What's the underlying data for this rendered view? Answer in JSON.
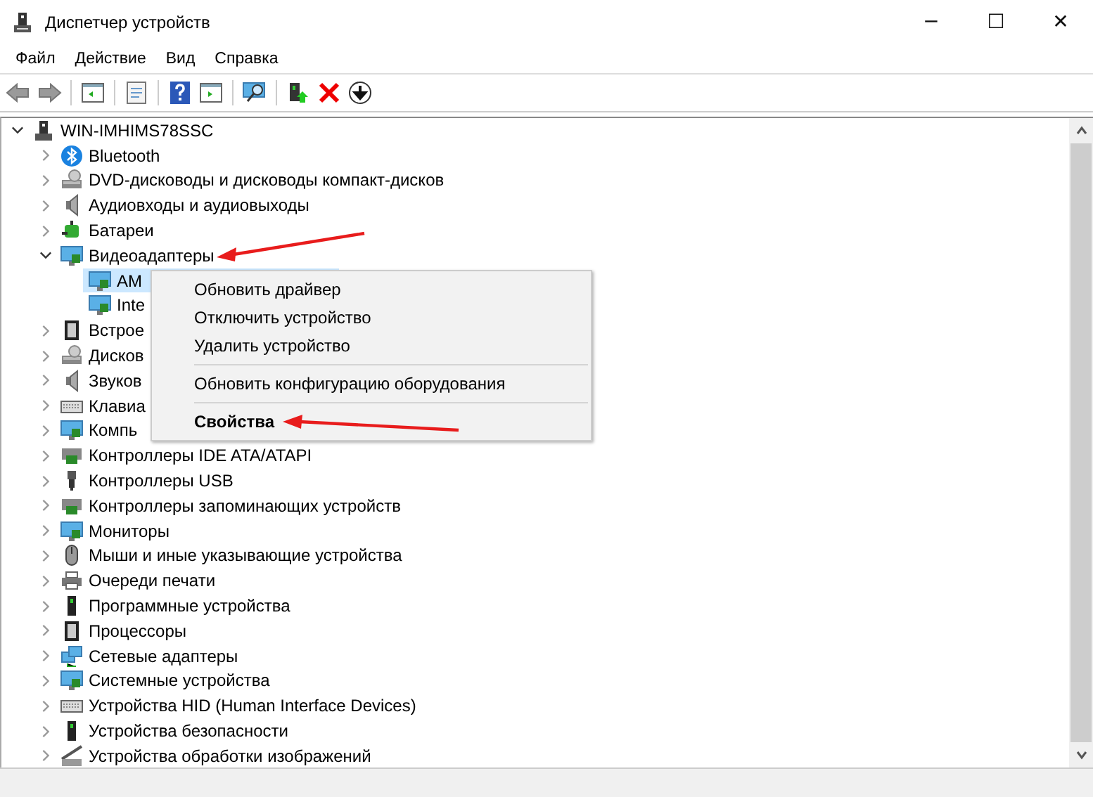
{
  "window": {
    "title": "Диспетчер устройств",
    "controls": [
      "─",
      "☐",
      "✕"
    ]
  },
  "menu": [
    "Файл",
    "Действие",
    "Вид",
    "Справка"
  ],
  "tree": [
    {
      "label": "WIN-IMHIMS78SSC",
      "expanded": true,
      "selected": false,
      "children": [
        {
          "label": "Bluetooth",
          "expanded": false,
          "selected": false
        },
        {
          "label": "DVD-дисководы и дисководы компакт-дисков",
          "expanded": false,
          "selected": false
        },
        {
          "label": "Аудиовходы и аудиовыходы",
          "expanded": false,
          "selected": false
        },
        {
          "label": "Батареи",
          "expanded": false,
          "selected": false
        },
        {
          "label": "Видеоадаптеры",
          "expanded": true,
          "selected": false,
          "children": [
            {
              "label": "AM",
              "selected": true
            },
            {
              "label": "Inte",
              "selected": false
            }
          ]
        },
        {
          "label": "Встрое",
          "expanded": false,
          "selected": false
        },
        {
          "label": "Дисков",
          "expanded": false,
          "selected": false
        },
        {
          "label": "Звуков",
          "expanded": false,
          "selected": false
        },
        {
          "label": "Клавиа",
          "expanded": false,
          "selected": false
        },
        {
          "label": "Компь",
          "expanded": false,
          "selected": false
        },
        {
          "label": "Контроллеры IDE ATA/ATAPI",
          "expanded": false,
          "selected": false
        },
        {
          "label": "Контроллеры USB",
          "expanded": false,
          "selected": false
        },
        {
          "label": "Контроллеры запоминающих устройств",
          "expanded": false,
          "selected": false
        },
        {
          "label": "Мониторы",
          "expanded": false,
          "selected": false
        },
        {
          "label": "Мыши и иные указывающие устройства",
          "expanded": false,
          "selected": false
        },
        {
          "label": "Очереди печати",
          "expanded": false,
          "selected": false
        },
        {
          "label": "Программные устройства",
          "expanded": false,
          "selected": false
        },
        {
          "label": "Процессоры",
          "expanded": false,
          "selected": false
        },
        {
          "label": "Сетевые адаптеры",
          "expanded": false,
          "selected": false
        },
        {
          "label": "Системные устройства",
          "expanded": false,
          "selected": false
        },
        {
          "label": "Устройства HID (Human Interface Devices)",
          "expanded": false,
          "selected": false
        },
        {
          "label": "Устройства безопасности",
          "expanded": false,
          "selected": false
        },
        {
          "label": "Устройства обработки изображений",
          "expanded": false,
          "selected": false
        }
      ]
    }
  ],
  "context_menu": [
    {
      "kind": "item",
      "label": "Обновить драйвер",
      "default": false
    },
    {
      "kind": "item",
      "label": "Отключить устройство",
      "default": false
    },
    {
      "kind": "item",
      "label": "Удалить устройство",
      "default": false
    },
    {
      "kind": "separator"
    },
    {
      "kind": "item",
      "label": "Обновить конфигурацию оборудования",
      "default": false
    },
    {
      "kind": "separator"
    },
    {
      "kind": "item",
      "label": "Свойства",
      "default": true
    }
  ]
}
